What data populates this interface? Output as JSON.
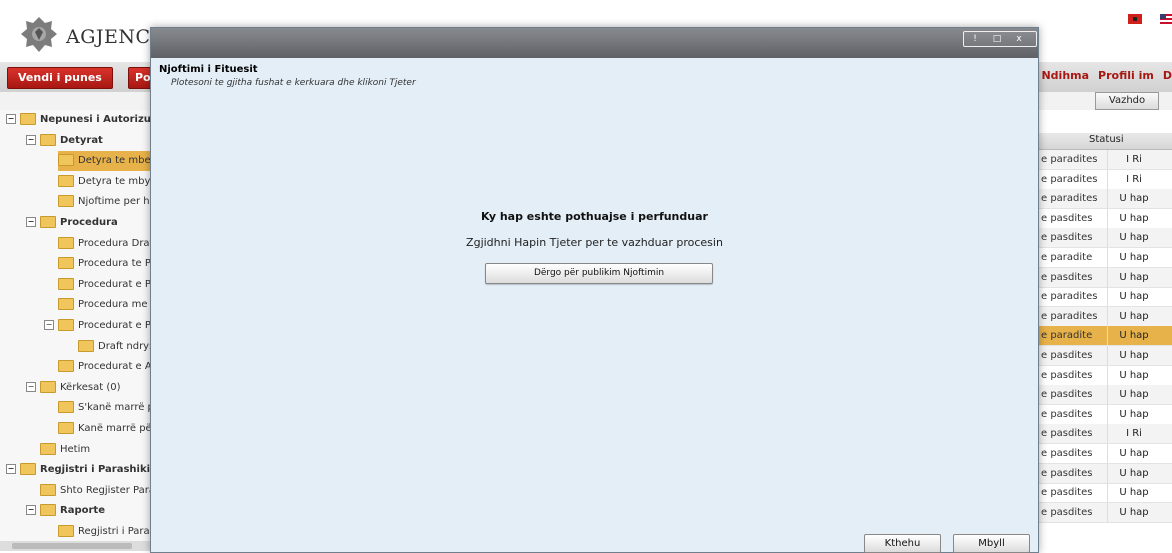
{
  "header": {
    "app_title": "AGJENCIA"
  },
  "nav": {
    "left_buttons": [
      "Vendi i punes",
      "Po"
    ],
    "right_links": [
      "Ndihma",
      "Profili im",
      "D"
    ],
    "continue_label": "Vazhdo"
  },
  "tree": {
    "items": [
      {
        "label": "Nepunesi i Autorizuar",
        "level": 0,
        "bold": true,
        "toggle": "−",
        "selected": false
      },
      {
        "label": "Detyrat",
        "level": 1,
        "bold": true,
        "toggle": "−",
        "selected": false
      },
      {
        "label": "Detyra te mbetur",
        "level": 2,
        "bold": false,
        "toggle": "",
        "selected": true
      },
      {
        "label": "Detyra te mbyllur",
        "level": 2,
        "bold": false,
        "toggle": "",
        "selected": false
      },
      {
        "label": "Njoftime per hapj",
        "level": 2,
        "bold": false,
        "toggle": "",
        "selected": false
      },
      {
        "label": "Procedura",
        "level": 1,
        "bold": true,
        "toggle": "−",
        "selected": false
      },
      {
        "label": "Procedura Draft",
        "level": 2,
        "bold": false,
        "toggle": "",
        "selected": false
      },
      {
        "label": "Procedura te Papu",
        "level": 2,
        "bold": false,
        "toggle": "",
        "selected": false
      },
      {
        "label": "Procedurat e Publ",
        "level": 2,
        "bold": false,
        "toggle": "",
        "selected": false
      },
      {
        "label": "Procedura me Lot",
        "level": 2,
        "bold": false,
        "toggle": "",
        "selected": false
      },
      {
        "label": "Procedurat e Pezu",
        "level": 2,
        "bold": false,
        "toggle": "−",
        "selected": false
      },
      {
        "label": "Draft ndryshin",
        "level": 3,
        "bold": false,
        "toggle": "",
        "selected": false
      },
      {
        "label": "Procedurat e Anul",
        "level": 2,
        "bold": false,
        "toggle": "",
        "selected": false
      },
      {
        "label": "Kërkesat (0)",
        "level": 1,
        "bold": false,
        "toggle": "−",
        "selected": false
      },
      {
        "label": "S'kanë marrë për",
        "level": 2,
        "bold": false,
        "toggle": "",
        "selected": false
      },
      {
        "label": "Kanë marrë përgj",
        "level": 2,
        "bold": false,
        "toggle": "",
        "selected": false
      },
      {
        "label": "Hetim",
        "level": 1,
        "bold": false,
        "toggle": "",
        "selected": false
      },
      {
        "label": "Regjistri i Parashikimi",
        "level": 0,
        "bold": true,
        "toggle": "−",
        "selected": false
      },
      {
        "label": "Shto Regjister Parash",
        "level": 1,
        "bold": false,
        "toggle": "",
        "selected": false
      },
      {
        "label": "Raporte",
        "level": 1,
        "bold": true,
        "toggle": "−",
        "selected": false
      },
      {
        "label": "Regjistri i Parashi",
        "level": 2,
        "bold": false,
        "toggle": "",
        "selected": false
      }
    ]
  },
  "grid": {
    "status_header": "Statusi",
    "rows": [
      {
        "time": "e paradites",
        "status": "I Ri",
        "alt": true,
        "hl": false
      },
      {
        "time": "e paradites",
        "status": "I Ri",
        "alt": false,
        "hl": false
      },
      {
        "time": "e paradites",
        "status": "U hap",
        "alt": true,
        "hl": false
      },
      {
        "time": "e pasdites",
        "status": "U hap",
        "alt": false,
        "hl": false
      },
      {
        "time": "e pasdites",
        "status": "U hap",
        "alt": true,
        "hl": false
      },
      {
        "time": "e paradite",
        "status": "U hap",
        "alt": false,
        "hl": false
      },
      {
        "time": "e pasdites",
        "status": "U hap",
        "alt": true,
        "hl": false
      },
      {
        "time": "e paradites",
        "status": "U hap",
        "alt": false,
        "hl": false
      },
      {
        "time": "e paradites",
        "status": "U hap",
        "alt": true,
        "hl": false
      },
      {
        "time": "e paradite",
        "status": "U hap",
        "alt": false,
        "hl": true
      },
      {
        "time": "e pasdites",
        "status": "U hap",
        "alt": true,
        "hl": false
      },
      {
        "time": "e pasdites",
        "status": "U hap",
        "alt": false,
        "hl": false
      },
      {
        "time": "e pasdites",
        "status": "U hap",
        "alt": true,
        "hl": false
      },
      {
        "time": "e pasdites",
        "status": "U hap",
        "alt": false,
        "hl": false
      },
      {
        "time": "e pasdites",
        "status": "I Ri",
        "alt": true,
        "hl": false
      },
      {
        "time": "e pasdites",
        "status": "U hap",
        "alt": false,
        "hl": false
      },
      {
        "time": "e pasdites",
        "status": "U hap",
        "alt": true,
        "hl": false
      },
      {
        "time": "e pasdites",
        "status": "U hap",
        "alt": false,
        "hl": false
      },
      {
        "time": "e pasdites",
        "status": "U hap",
        "alt": true,
        "hl": false
      }
    ]
  },
  "modal": {
    "window_buttons": [
      "!",
      "□",
      "x"
    ],
    "heading": "Njoftimi i Fituesit",
    "subtitle": "Plotesoni te gjitha fushat e kerkuara dhe klikoni Tjeter",
    "center_title": "Ky hap eshte pothuajse i perfunduar",
    "center_desc": "Zgjidhni Hapin Tjeter per te vazhduar procesin",
    "publish_button": "Dërgo për publikim Njoftimin",
    "back_button": "Kthehu",
    "close_button": "Mbyll"
  },
  "colors": {
    "brand_red": "#c4261f",
    "selection": "#e8b24a",
    "modal_bg": "#e3eef7",
    "titlebar": "#6f7277"
  }
}
